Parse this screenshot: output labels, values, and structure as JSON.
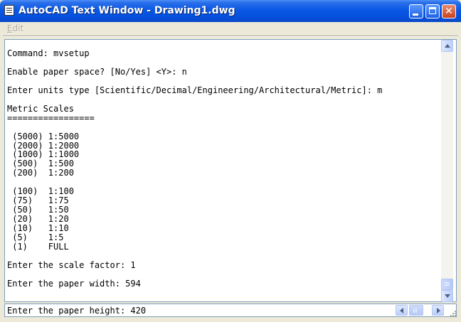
{
  "window": {
    "title": "AutoCAD Text Window - Drawing1.dwg",
    "icon": "text-window-icon",
    "controls": [
      "minimize-icon",
      "maximize-icon",
      "close-icon"
    ]
  },
  "menu": {
    "items": [
      {
        "label": "Edit",
        "mnemonic": "E",
        "rest": "dit",
        "enabled": false
      }
    ]
  },
  "history": {
    "lines": [
      "Command: mvsetup",
      "",
      "Enable paper space? [No/Yes] <Y>: n",
      "",
      "Enter units type [Scientific/Decimal/Engineering/Architectural/Metric]: m",
      "",
      "Metric Scales",
      "=================",
      "",
      " (5000) 1:5000",
      " (2000) 1:2000",
      " (1000) 1:1000",
      " (500)  1:500",
      " (200)  1:200",
      "",
      " (100)  1:100",
      " (75)   1:75",
      " (50)   1:50",
      " (20)   1:20",
      " (10)   1:10",
      " (5)    1:5",
      " (1)    FULL",
      "",
      "Enter the scale factor: 1",
      "",
      "Enter the paper width: 594"
    ]
  },
  "command_line": {
    "text": "Enter the paper height: 420"
  },
  "colors": {
    "title_bar": "#0a58e6",
    "close_button": "#c9421f",
    "window_face": "#ece9d8",
    "text_bg": "#ffffff",
    "field_border": "#7f9db9"
  }
}
